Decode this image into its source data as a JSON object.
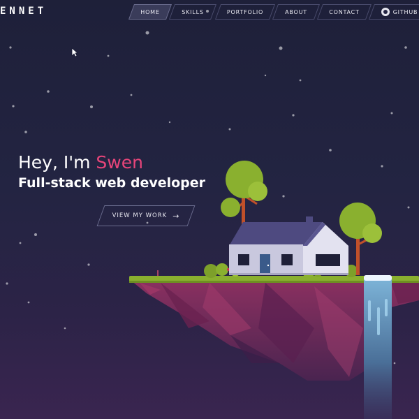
{
  "brand": {
    "logo_text": "ENNET"
  },
  "nav": {
    "items": [
      {
        "label": "HOME",
        "active": true
      },
      {
        "label": "SKILLS",
        "active": false
      },
      {
        "label": "PORTFOLIO",
        "active": false
      },
      {
        "label": "ABOUT",
        "active": false
      },
      {
        "label": "CONTACT",
        "active": false
      },
      {
        "label": "GITHUB",
        "active": false,
        "icon": "github-icon"
      }
    ]
  },
  "hero": {
    "greeting_prefix": "Hey, I'm ",
    "name": "Swen",
    "subtitle": "Full-stack web developer",
    "cta_label": "VIEW MY WORK",
    "cta_icon": "arrow-right-icon"
  },
  "colors": {
    "background_top": "#1e2039",
    "background_bottom": "#3a2550",
    "accent": "#e8457a",
    "grass": "#8ab02f",
    "rock": "#7a2a55",
    "house_wall": "#c9c8de",
    "house_roof": "#4e4a80",
    "waterfall": "#6fa8cf"
  }
}
